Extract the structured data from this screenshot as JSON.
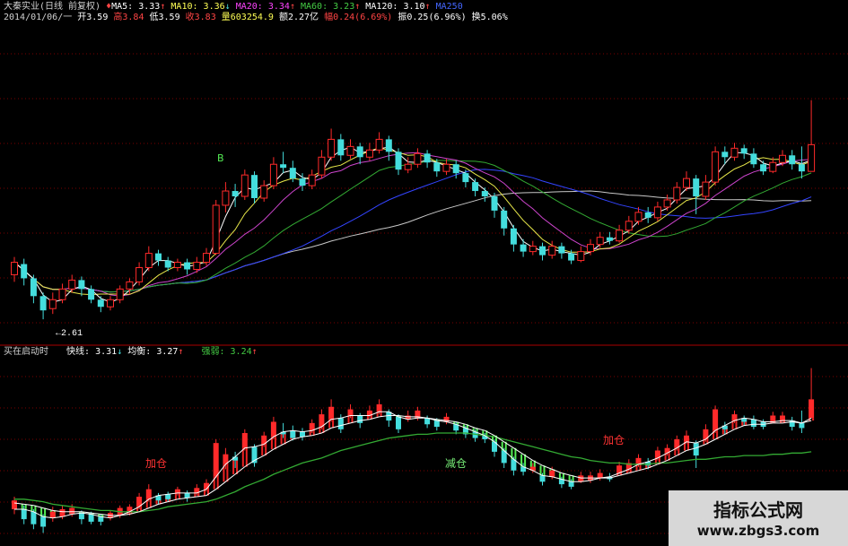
{
  "header": {
    "title": "大秦实业(日线 前复权)",
    "ma5_label": "MA5:",
    "ma5_value": "3.33",
    "ma10_label": "MA10:",
    "ma10_value": "3.36",
    "ma20_label": "MA20:",
    "ma20_value": "3.34",
    "ma60_label": "MA60:",
    "ma60_value": "3.23",
    "ma120_label": "MA120:",
    "ma120_value": "3.10",
    "ma250_label": "MA250",
    "date": "2014/01/06/一",
    "open": "开3.59",
    "high": "高3.84",
    "low": "低3.59",
    "close": "收3.83",
    "volume": "量603254.9",
    "amount": "额2.27亿",
    "change": "幅0.24(6.69%)",
    "amplitude": "振0.25(6.96%)",
    "turnover": "换5.06%"
  },
  "indicator": {
    "name": "买在启动时",
    "fast_label": "快线:",
    "fast_value": "3.31",
    "mid_label": "均衡:",
    "mid_value": "3.27",
    "strong_label": "强弱:",
    "strong_value": "3.24"
  },
  "annotations": {
    "low_mark": "←2.61",
    "add1": "加仓",
    "add2": "加仓",
    "reduce": "减仓",
    "b_mark": "B"
  },
  "watermark": {
    "title": "指标公式网",
    "url": "www.zbgs3.com"
  },
  "colors": {
    "up": "#ff2a2a",
    "down": "#44dddd",
    "ma5": "#ffffff",
    "ma10": "#e8e84a",
    "ma20": "#cc44cc",
    "ma60": "#33aa33",
    "ma120": "#3344ff",
    "ma250": "#c8c8c8",
    "grid": "#7a0000",
    "hdr_red": "#ff4444",
    "hdr_magenta": "#ff44ff",
    "hdr_green": "#44cc44",
    "hdr_blue": "#4466ff",
    "hdr_yellow": "#ffff55"
  },
  "chart_data": [
    {
      "type": "candlestick",
      "title": "大秦实业(日线 前复权)",
      "ylim": [
        2.5,
        4.1
      ],
      "candles": [
        {
          "o": 2.86,
          "c": 2.93,
          "h": 2.96,
          "l": 2.82
        },
        {
          "o": 2.92,
          "c": 2.84,
          "h": 2.95,
          "l": 2.8
        },
        {
          "o": 2.84,
          "c": 2.74,
          "h": 2.86,
          "l": 2.7
        },
        {
          "o": 2.74,
          "c": 2.66,
          "h": 2.76,
          "l": 2.61
        },
        {
          "o": 2.67,
          "c": 2.72,
          "h": 2.76,
          "l": 2.64
        },
        {
          "o": 2.72,
          "c": 2.78,
          "h": 2.81,
          "l": 2.7
        },
        {
          "o": 2.78,
          "c": 2.83,
          "h": 2.86,
          "l": 2.76
        },
        {
          "o": 2.83,
          "c": 2.78,
          "h": 2.85,
          "l": 2.74
        },
        {
          "o": 2.78,
          "c": 2.72,
          "h": 2.8,
          "l": 2.7
        },
        {
          "o": 2.72,
          "c": 2.68,
          "h": 2.74,
          "l": 2.65
        },
        {
          "o": 2.68,
          "c": 2.72,
          "h": 2.74,
          "l": 2.66
        },
        {
          "o": 2.72,
          "c": 2.78,
          "h": 2.8,
          "l": 2.7
        },
        {
          "o": 2.78,
          "c": 2.82,
          "h": 2.84,
          "l": 2.75
        },
        {
          "o": 2.82,
          "c": 2.9,
          "h": 2.93,
          "l": 2.8
        },
        {
          "o": 2.9,
          "c": 2.98,
          "h": 3.02,
          "l": 2.88
        },
        {
          "o": 2.98,
          "c": 2.94,
          "h": 3.0,
          "l": 2.91
        },
        {
          "o": 2.94,
          "c": 2.9,
          "h": 2.96,
          "l": 2.88
        },
        {
          "o": 2.9,
          "c": 2.93,
          "h": 2.95,
          "l": 2.88
        },
        {
          "o": 2.93,
          "c": 2.89,
          "h": 2.95,
          "l": 2.86
        },
        {
          "o": 2.89,
          "c": 2.93,
          "h": 2.96,
          "l": 2.87
        },
        {
          "o": 2.93,
          "c": 2.98,
          "h": 3.01,
          "l": 2.91
        },
        {
          "o": 2.98,
          "c": 3.25,
          "h": 3.28,
          "l": 2.97
        },
        {
          "o": 3.25,
          "c": 3.33,
          "h": 3.38,
          "l": 3.21
        },
        {
          "o": 3.33,
          "c": 3.3,
          "h": 3.37,
          "l": 3.24
        },
        {
          "o": 3.3,
          "c": 3.42,
          "h": 3.45,
          "l": 3.28
        },
        {
          "o": 3.42,
          "c": 3.29,
          "h": 3.44,
          "l": 3.26
        },
        {
          "o": 3.29,
          "c": 3.36,
          "h": 3.39,
          "l": 3.27
        },
        {
          "o": 3.36,
          "c": 3.48,
          "h": 3.52,
          "l": 3.34
        },
        {
          "o": 3.48,
          "c": 3.46,
          "h": 3.55,
          "l": 3.43
        },
        {
          "o": 3.46,
          "c": 3.4,
          "h": 3.5,
          "l": 3.38
        },
        {
          "o": 3.4,
          "c": 3.36,
          "h": 3.43,
          "l": 3.33
        },
        {
          "o": 3.36,
          "c": 3.42,
          "h": 3.45,
          "l": 3.34
        },
        {
          "o": 3.42,
          "c": 3.52,
          "h": 3.56,
          "l": 3.4
        },
        {
          "o": 3.52,
          "c": 3.62,
          "h": 3.68,
          "l": 3.5
        },
        {
          "o": 3.62,
          "c": 3.53,
          "h": 3.65,
          "l": 3.5
        },
        {
          "o": 3.53,
          "c": 3.58,
          "h": 3.62,
          "l": 3.51
        },
        {
          "o": 3.58,
          "c": 3.52,
          "h": 3.6,
          "l": 3.48
        },
        {
          "o": 3.52,
          "c": 3.56,
          "h": 3.6,
          "l": 3.5
        },
        {
          "o": 3.56,
          "c": 3.62,
          "h": 3.66,
          "l": 3.54
        },
        {
          "o": 3.62,
          "c": 3.55,
          "h": 3.64,
          "l": 3.5
        },
        {
          "o": 3.55,
          "c": 3.45,
          "h": 3.57,
          "l": 3.42
        },
        {
          "o": 3.45,
          "c": 3.48,
          "h": 3.52,
          "l": 3.43
        },
        {
          "o": 3.48,
          "c": 3.54,
          "h": 3.57,
          "l": 3.46
        },
        {
          "o": 3.54,
          "c": 3.49,
          "h": 3.56,
          "l": 3.46
        },
        {
          "o": 3.49,
          "c": 3.44,
          "h": 3.51,
          "l": 3.41
        },
        {
          "o": 3.44,
          "c": 3.48,
          "h": 3.51,
          "l": 3.42
        },
        {
          "o": 3.48,
          "c": 3.43,
          "h": 3.5,
          "l": 3.4
        },
        {
          "o": 3.43,
          "c": 3.38,
          "h": 3.45,
          "l": 3.35
        },
        {
          "o": 3.38,
          "c": 3.33,
          "h": 3.4,
          "l": 3.3
        },
        {
          "o": 3.33,
          "c": 3.3,
          "h": 3.35,
          "l": 3.27
        },
        {
          "o": 3.3,
          "c": 3.22,
          "h": 3.32,
          "l": 3.18
        },
        {
          "o": 3.22,
          "c": 3.12,
          "h": 3.24,
          "l": 3.08
        },
        {
          "o": 3.12,
          "c": 3.03,
          "h": 3.14,
          "l": 2.99
        },
        {
          "o": 3.03,
          "c": 2.99,
          "h": 3.06,
          "l": 2.96
        },
        {
          "o": 2.99,
          "c": 3.02,
          "h": 3.05,
          "l": 2.97
        },
        {
          "o": 3.02,
          "c": 2.97,
          "h": 3.04,
          "l": 2.94
        },
        {
          "o": 2.97,
          "c": 3.02,
          "h": 3.05,
          "l": 2.95
        },
        {
          "o": 3.02,
          "c": 2.98,
          "h": 3.04,
          "l": 2.95
        },
        {
          "o": 2.98,
          "c": 2.94,
          "h": 3.0,
          "l": 2.92
        },
        {
          "o": 2.94,
          "c": 2.99,
          "h": 3.02,
          "l": 2.93
        },
        {
          "o": 2.99,
          "c": 3.03,
          "h": 3.06,
          "l": 2.97
        },
        {
          "o": 3.03,
          "c": 3.07,
          "h": 3.1,
          "l": 3.01
        },
        {
          "o": 3.07,
          "c": 3.05,
          "h": 3.1,
          "l": 3.03
        },
        {
          "o": 3.05,
          "c": 3.11,
          "h": 3.14,
          "l": 3.04
        },
        {
          "o": 3.11,
          "c": 3.16,
          "h": 3.19,
          "l": 3.09
        },
        {
          "o": 3.16,
          "c": 3.21,
          "h": 3.24,
          "l": 3.14
        },
        {
          "o": 3.21,
          "c": 3.18,
          "h": 3.24,
          "l": 3.15
        },
        {
          "o": 3.18,
          "c": 3.24,
          "h": 3.27,
          "l": 3.16
        },
        {
          "o": 3.24,
          "c": 3.28,
          "h": 3.31,
          "l": 3.22
        },
        {
          "o": 3.28,
          "c": 3.35,
          "h": 3.38,
          "l": 3.26
        },
        {
          "o": 3.35,
          "c": 3.4,
          "h": 3.44,
          "l": 3.33
        },
        {
          "o": 3.4,
          "c": 3.3,
          "h": 3.42,
          "l": 3.2
        },
        {
          "o": 3.3,
          "c": 3.38,
          "h": 3.42,
          "l": 3.28
        },
        {
          "o": 3.38,
          "c": 3.55,
          "h": 3.58,
          "l": 3.36
        },
        {
          "o": 3.55,
          "c": 3.52,
          "h": 3.58,
          "l": 3.48
        },
        {
          "o": 3.52,
          "c": 3.57,
          "h": 3.6,
          "l": 3.5
        },
        {
          "o": 3.57,
          "c": 3.54,
          "h": 3.59,
          "l": 3.51
        },
        {
          "o": 3.54,
          "c": 3.48,
          "h": 3.57,
          "l": 3.46
        },
        {
          "o": 3.48,
          "c": 3.44,
          "h": 3.5,
          "l": 3.42
        },
        {
          "o": 3.44,
          "c": 3.49,
          "h": 3.52,
          "l": 3.43
        },
        {
          "o": 3.49,
          "c": 3.53,
          "h": 3.56,
          "l": 3.47
        },
        {
          "o": 3.53,
          "c": 3.48,
          "h": 3.56,
          "l": 3.45
        },
        {
          "o": 3.48,
          "c": 3.44,
          "h": 3.58,
          "l": 3.4
        },
        {
          "o": 3.44,
          "c": 3.59,
          "h": 3.84,
          "l": 3.59
        }
      ]
    },
    {
      "type": "line",
      "title": "买在启动时",
      "ylim": [
        2.55,
        3.95
      ],
      "series": [
        {
          "name": "快线",
          "values": [
            2.78,
            2.78,
            2.76,
            2.72,
            2.71,
            2.72,
            2.74,
            2.75,
            2.74,
            2.72,
            2.71,
            2.73,
            2.76,
            2.8,
            2.86,
            2.89,
            2.9,
            2.91,
            2.91,
            2.91,
            2.94,
            3.04,
            3.14,
            3.2,
            3.27,
            3.28,
            3.3,
            3.36,
            3.4,
            3.41,
            3.4,
            3.41,
            3.44,
            3.5,
            3.51,
            3.53,
            3.53,
            3.53,
            3.56,
            3.56,
            3.52,
            3.5,
            3.51,
            3.51,
            3.49,
            3.48,
            3.46,
            3.43,
            3.4,
            3.37,
            3.32,
            3.25,
            3.18,
            3.12,
            3.09,
            3.05,
            3.04,
            3.02,
            3.0,
            3.0,
            3.01,
            3.03,
            3.04,
            3.07,
            3.1,
            3.14,
            3.16,
            3.19,
            3.23,
            3.27,
            3.32,
            3.31,
            3.34,
            3.41,
            3.45,
            3.49,
            3.51,
            3.5,
            3.48,
            3.48,
            3.49,
            3.49,
            3.47,
            3.51
          ]
        },
        {
          "name": "均衡",
          "values": [
            2.83,
            2.82,
            2.81,
            2.79,
            2.77,
            2.76,
            2.76,
            2.76,
            2.75,
            2.74,
            2.73,
            2.73,
            2.74,
            2.76,
            2.79,
            2.82,
            2.84,
            2.86,
            2.87,
            2.88,
            2.89,
            2.94,
            3.0,
            3.06,
            3.12,
            3.17,
            3.21,
            3.26,
            3.3,
            3.34,
            3.36,
            3.37,
            3.39,
            3.43,
            3.45,
            3.47,
            3.49,
            3.5,
            3.52,
            3.53,
            3.53,
            3.52,
            3.52,
            3.51,
            3.5,
            3.49,
            3.48,
            3.46,
            3.43,
            3.41,
            3.37,
            3.32,
            3.27,
            3.22,
            3.17,
            3.13,
            3.1,
            3.07,
            3.05,
            3.03,
            3.03,
            3.03,
            3.03,
            3.05,
            3.07,
            3.09,
            3.11,
            3.14,
            3.17,
            3.21,
            3.25,
            3.27,
            3.3,
            3.34,
            3.38,
            3.42,
            3.45,
            3.46,
            3.46,
            3.47,
            3.47,
            3.48,
            3.47,
            3.49
          ]
        },
        {
          "name": "强弱",
          "values": [
            2.86,
            2.86,
            2.85,
            2.84,
            2.82,
            2.81,
            2.8,
            2.79,
            2.78,
            2.77,
            2.77,
            2.76,
            2.76,
            2.76,
            2.77,
            2.78,
            2.8,
            2.81,
            2.82,
            2.83,
            2.84,
            2.86,
            2.89,
            2.92,
            2.96,
            2.99,
            3.02,
            3.06,
            3.09,
            3.12,
            3.15,
            3.17,
            3.19,
            3.22,
            3.25,
            3.27,
            3.29,
            3.31,
            3.33,
            3.35,
            3.36,
            3.37,
            3.38,
            3.38,
            3.39,
            3.39,
            3.39,
            3.39,
            3.38,
            3.37,
            3.36,
            3.34,
            3.32,
            3.3,
            3.28,
            3.26,
            3.24,
            3.22,
            3.2,
            3.19,
            3.17,
            3.16,
            3.15,
            3.15,
            3.14,
            3.14,
            3.14,
            3.15,
            3.15,
            3.16,
            3.17,
            3.18,
            3.18,
            3.19,
            3.2,
            3.2,
            3.21,
            3.21,
            3.21,
            3.22,
            3.22,
            3.23,
            3.23,
            3.24
          ]
        }
      ]
    }
  ]
}
